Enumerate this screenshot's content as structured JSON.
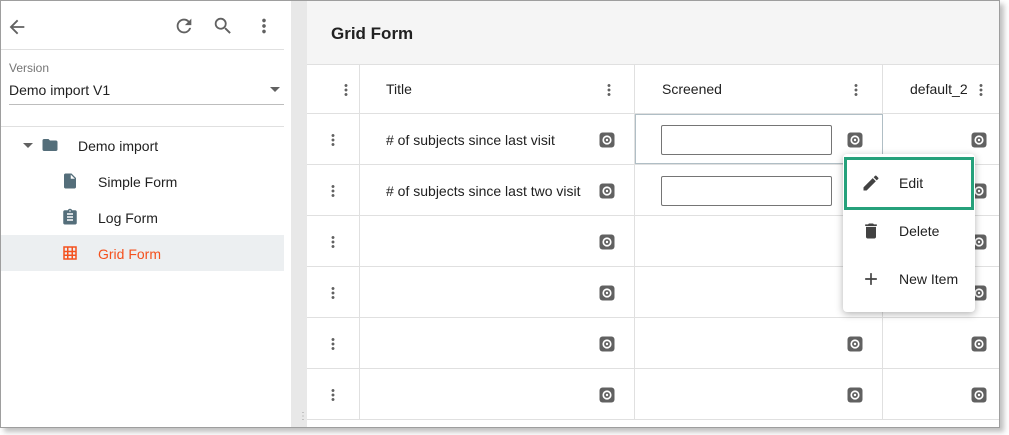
{
  "sidebar": {
    "version_label": "Version",
    "version_value": "Demo import V1",
    "tree": {
      "root_label": "Demo import",
      "items": [
        {
          "label": "Simple Form",
          "icon": "document-icon"
        },
        {
          "label": "Log Form",
          "icon": "clipboard-icon"
        },
        {
          "label": "Grid Form",
          "icon": "grid-icon",
          "selected": true
        }
      ]
    }
  },
  "main": {
    "title": "Grid Form",
    "columns": [
      "Title",
      "Screened",
      "default_2"
    ],
    "rows": [
      {
        "title": "# of subjects since last visit",
        "screened_input": ""
      },
      {
        "title": "# of subjects since last two visit",
        "screened_input": ""
      },
      {
        "title": ""
      },
      {
        "title": ""
      },
      {
        "title": ""
      },
      {
        "title": ""
      }
    ]
  },
  "context_menu": {
    "items": [
      {
        "label": "Edit",
        "icon": "pencil-icon"
      },
      {
        "label": "Delete",
        "icon": "trash-icon"
      },
      {
        "label": "New Item",
        "icon": "plus-icon"
      }
    ]
  },
  "colors": {
    "accent": "#f4511e",
    "folder": "#546e7a",
    "highlight": "#26a17b",
    "gear": "#616161"
  }
}
